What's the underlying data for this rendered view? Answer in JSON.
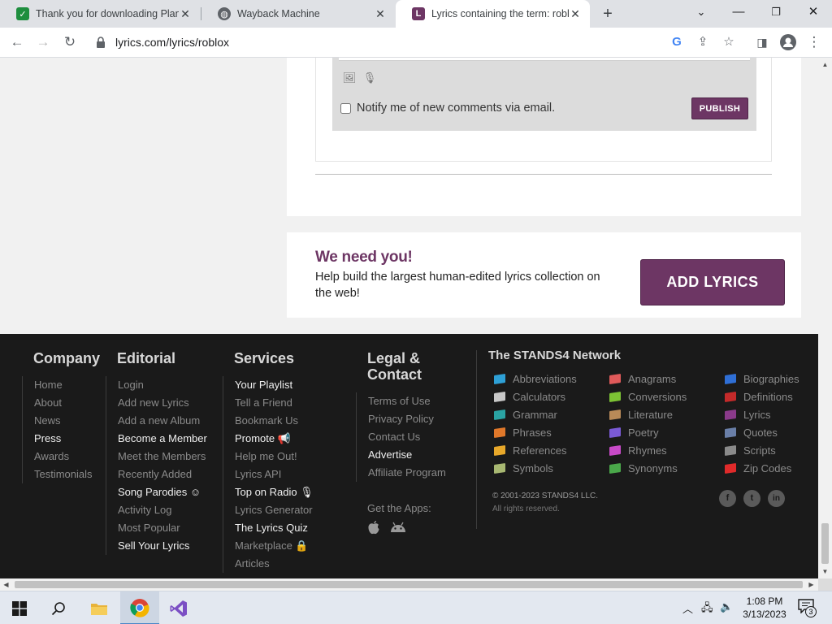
{
  "browser": {
    "tabs": [
      {
        "title": "Thank you for downloading Plant",
        "favicon_color": "#1e8e3e",
        "favicon_glyph": "✓"
      },
      {
        "title": "Wayback Machine",
        "favicon_color": "#5f6368",
        "favicon_glyph": "globe-icon"
      },
      {
        "title": "Lyrics containing the term: roblox",
        "favicon_color": "#6d3664",
        "favicon_glyph": "L"
      }
    ],
    "url": "lyrics.com/lyrics/roblox"
  },
  "comment_form": {
    "notify_label": "Notify me of new comments via email.",
    "publish_label": "PUBLISH"
  },
  "cta": {
    "heading": "We need you!",
    "text": "Help build the largest human-edited lyrics collection on the web!",
    "button": "ADD LYRICS"
  },
  "footer": {
    "company": {
      "heading": "Company",
      "items": [
        {
          "label": "Home",
          "highlight": false
        },
        {
          "label": "About",
          "highlight": false
        },
        {
          "label": "News",
          "highlight": false
        },
        {
          "label": "Press",
          "highlight": true
        },
        {
          "label": "Awards",
          "highlight": false
        },
        {
          "label": "Testimonials",
          "highlight": false
        }
      ]
    },
    "editorial": {
      "heading": "Editorial",
      "items": [
        {
          "label": "Login",
          "highlight": false
        },
        {
          "label": "Add new Lyrics",
          "highlight": false
        },
        {
          "label": "Add a new Album",
          "highlight": false
        },
        {
          "label": "Become a Member",
          "highlight": true
        },
        {
          "label": "Meet the Members",
          "highlight": false
        },
        {
          "label": "Recently Added",
          "highlight": false
        },
        {
          "label": "Song Parodies ☺",
          "highlight": true
        },
        {
          "label": "Activity Log",
          "highlight": false
        },
        {
          "label": "Most Popular",
          "highlight": false
        },
        {
          "label": "Sell Your Lyrics",
          "highlight": true
        }
      ]
    },
    "services": {
      "heading": "Services",
      "items": [
        {
          "label": "Your Playlist",
          "highlight": true
        },
        {
          "label": "Tell a Friend",
          "highlight": false
        },
        {
          "label": "Bookmark Us",
          "highlight": false
        },
        {
          "label": "Promote 📢",
          "highlight": true
        },
        {
          "label": "Help me Out!",
          "highlight": false
        },
        {
          "label": "Lyrics API",
          "highlight": false
        },
        {
          "label": "Top on Radio 🎙",
          "highlight": true
        },
        {
          "label": "Lyrics Generator",
          "highlight": false
        },
        {
          "label": "The Lyrics Quiz",
          "highlight": true
        },
        {
          "label": "Marketplace 🔒",
          "highlight": false
        },
        {
          "label": "Articles",
          "highlight": false
        }
      ]
    },
    "legal": {
      "heading_line1": "Legal &",
      "heading_line2": "Contact",
      "items": [
        {
          "label": "Terms of Use",
          "highlight": false
        },
        {
          "label": "Privacy Policy",
          "highlight": false
        },
        {
          "label": "Contact Us",
          "highlight": false
        },
        {
          "label": "Advertise",
          "highlight": true
        },
        {
          "label": "Affiliate Program",
          "highlight": false
        }
      ],
      "apps_label": "Get the Apps:"
    },
    "network": {
      "heading": "The STANDS4 Network",
      "items": [
        {
          "label": "Abbreviations",
          "color": "#2ea0d6"
        },
        {
          "label": "Anagrams",
          "color": "#e05a5a"
        },
        {
          "label": "Biographies",
          "color": "#2f6fd6"
        },
        {
          "label": "Calculators",
          "color": "#c8c8c8"
        },
        {
          "label": "Conversions",
          "color": "#7cc234"
        },
        {
          "label": "Definitions",
          "color": "#c42a2a"
        },
        {
          "label": "Grammar",
          "color": "#2aa3a3"
        },
        {
          "label": "Literature",
          "color": "#b98a58"
        },
        {
          "label": "Lyrics",
          "color": "#8a3a8a"
        },
        {
          "label": "Phrases",
          "color": "#e0782a"
        },
        {
          "label": "Poetry",
          "color": "#7a5ad6"
        },
        {
          "label": "Quotes",
          "color": "#6a7fa8"
        },
        {
          "label": "References",
          "color": "#e8a82a"
        },
        {
          "label": "Rhymes",
          "color": "#c84ac8"
        },
        {
          "label": "Scripts",
          "color": "#8a8a8a"
        },
        {
          "label": "Symbols",
          "color": "#a8b872"
        },
        {
          "label": "Synonyms",
          "color": "#4aa84a"
        },
        {
          "label": "Zip Codes",
          "color": "#e02a2a"
        }
      ],
      "copyright": "© 2001-2023 STANDS4 LLC.",
      "rights": "All rights reserved."
    }
  },
  "taskbar": {
    "time": "1:08 PM",
    "date": "3/13/2023",
    "notification_count": "3"
  }
}
